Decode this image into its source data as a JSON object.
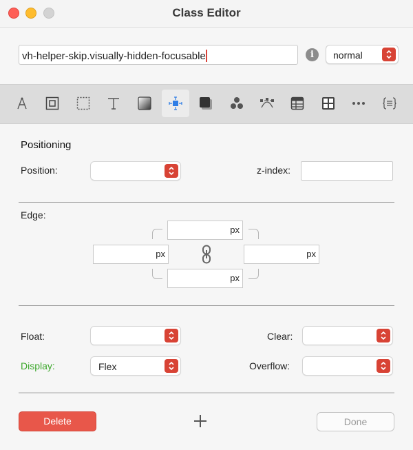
{
  "window": {
    "title": "Class Editor"
  },
  "class_name": {
    "value": "vh-helper-skip.visually-hidden-focusable"
  },
  "info": {
    "glyph": "i"
  },
  "state": {
    "selected": "normal"
  },
  "toolbar": {
    "active_tool": "positioning",
    "tools": [
      "typography",
      "box",
      "border",
      "text",
      "background",
      "positioning",
      "shadow",
      "effects",
      "transforms",
      "grid",
      "layout",
      "more",
      "custom-css"
    ]
  },
  "positioning": {
    "title": "Positioning",
    "position_label": "Position:",
    "position_value": "",
    "zindex_label": "z-index:",
    "zindex_value": ""
  },
  "edge": {
    "label": "Edge:",
    "unit": "px",
    "top": "",
    "right": "",
    "bottom": "",
    "left": ""
  },
  "layout": {
    "float_label": "Float:",
    "float_value": "",
    "clear_label": "Clear:",
    "clear_value": "",
    "display_label": "Display:",
    "display_value": "Flex",
    "overflow_label": "Overflow:",
    "overflow_value": ""
  },
  "footer": {
    "delete_label": "Delete",
    "done_label": "Done"
  },
  "colors": {
    "accent_red": "#d84335",
    "delete_red": "#e8574a",
    "display_green": "#3da82c",
    "active_tool_blue": "#2f7ee6"
  }
}
